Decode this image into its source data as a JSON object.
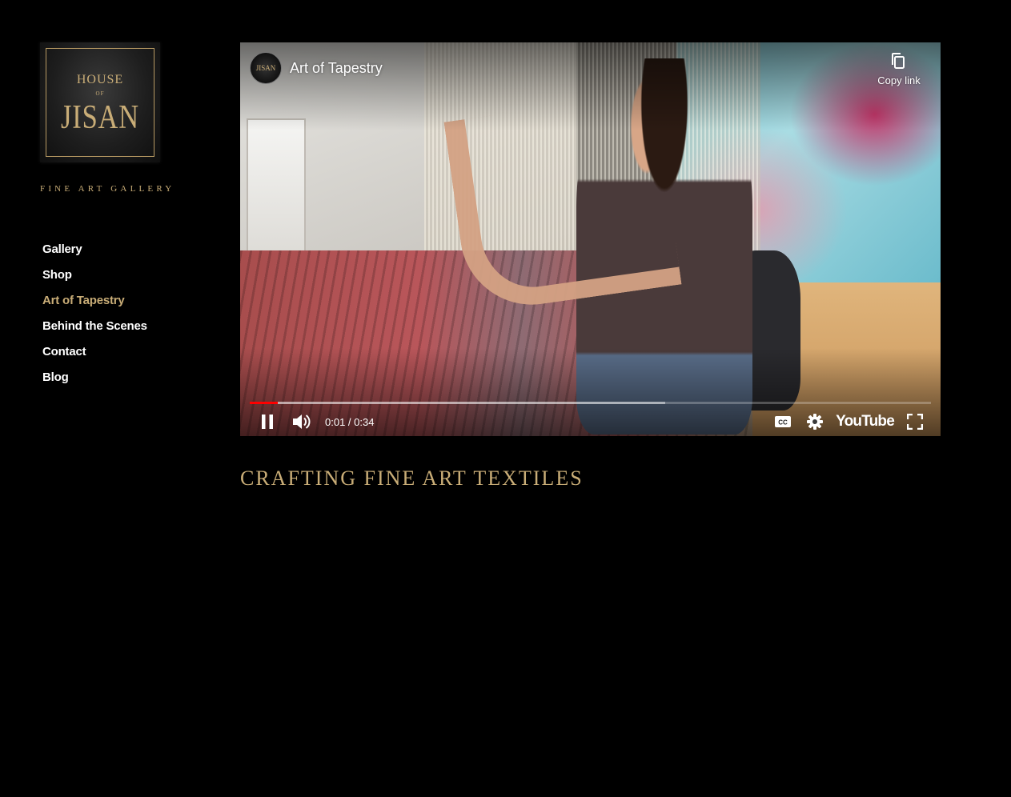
{
  "brand": {
    "logo_line1": "HOUSE",
    "logo_line2": "OF",
    "logo_line3": "JISAN",
    "tagline": "FINE ART GALLERY"
  },
  "nav": {
    "items": [
      {
        "label": "Gallery"
      },
      {
        "label": "Shop"
      },
      {
        "label": "Art of Tapestry",
        "active": true
      },
      {
        "label": "Behind the Scenes"
      },
      {
        "label": "Contact"
      },
      {
        "label": "Blog"
      }
    ]
  },
  "video": {
    "channel_avatar_text": "JISAN",
    "title": "Art of Tapestry",
    "copy_link_label": "Copy link",
    "time": "0:01 / 0:34",
    "played_fraction": 0.041,
    "loaded_fraction": 0.61,
    "brand_label": "YouTube",
    "icons": [
      "copy-icon",
      "pause-icon",
      "volume-icon",
      "cc-icon",
      "settings-gear-icon",
      "fullscreen-icon"
    ]
  },
  "content": {
    "heading": "CRAFTING FINE ART TEXTILES"
  },
  "colors": {
    "background": "#000000",
    "accent_gold": "#c9ad77",
    "nav_text": "#ffffff",
    "progress_played": "#ff0000"
  }
}
